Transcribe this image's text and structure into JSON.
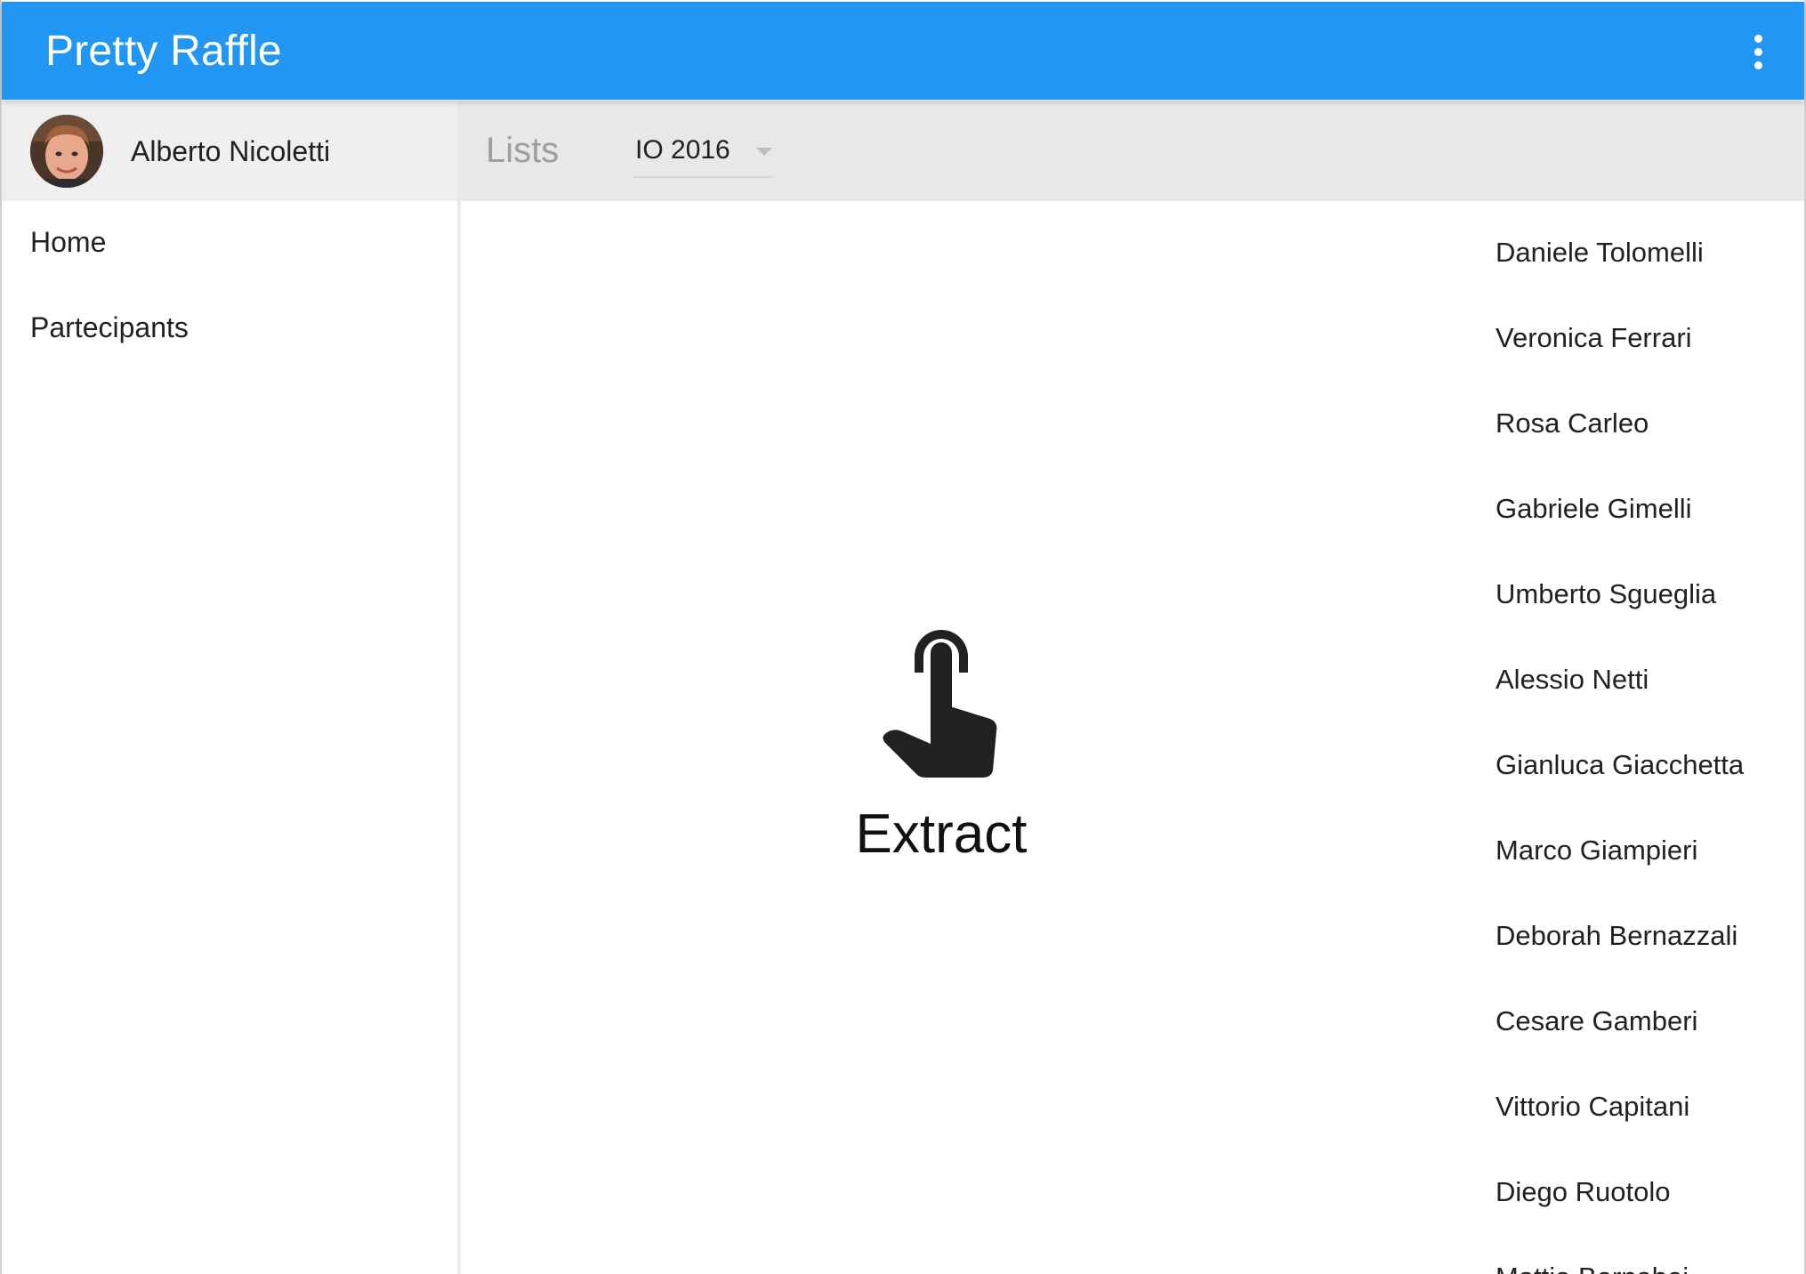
{
  "app": {
    "title": "Pretty Raffle",
    "overflow_menu_icon": "more-vert-icon",
    "accent_color": "#2196f3"
  },
  "user": {
    "name": "Alberto Nicoletti",
    "avatar_icon": "user-avatar"
  },
  "lists": {
    "label": "Lists",
    "selected": "IO 2016"
  },
  "sidebar": {
    "items": [
      {
        "label": "Home"
      },
      {
        "label": "Partecipants"
      }
    ]
  },
  "main": {
    "extract_icon": "touch-app-icon",
    "extract_label": "Extract"
  },
  "participants": [
    "Daniele Tolomelli",
    "Veronica Ferrari",
    "Rosa Carleo",
    "Gabriele Gimelli",
    "Umberto Sgueglia",
    "Alessio Netti",
    "Gianluca Giacchetta",
    "Marco Giampieri",
    "Deborah Bernazzali",
    "Cesare Gamberi",
    "Vittorio Capitani",
    "Diego Ruotolo",
    "Mattia Bernabei"
  ]
}
